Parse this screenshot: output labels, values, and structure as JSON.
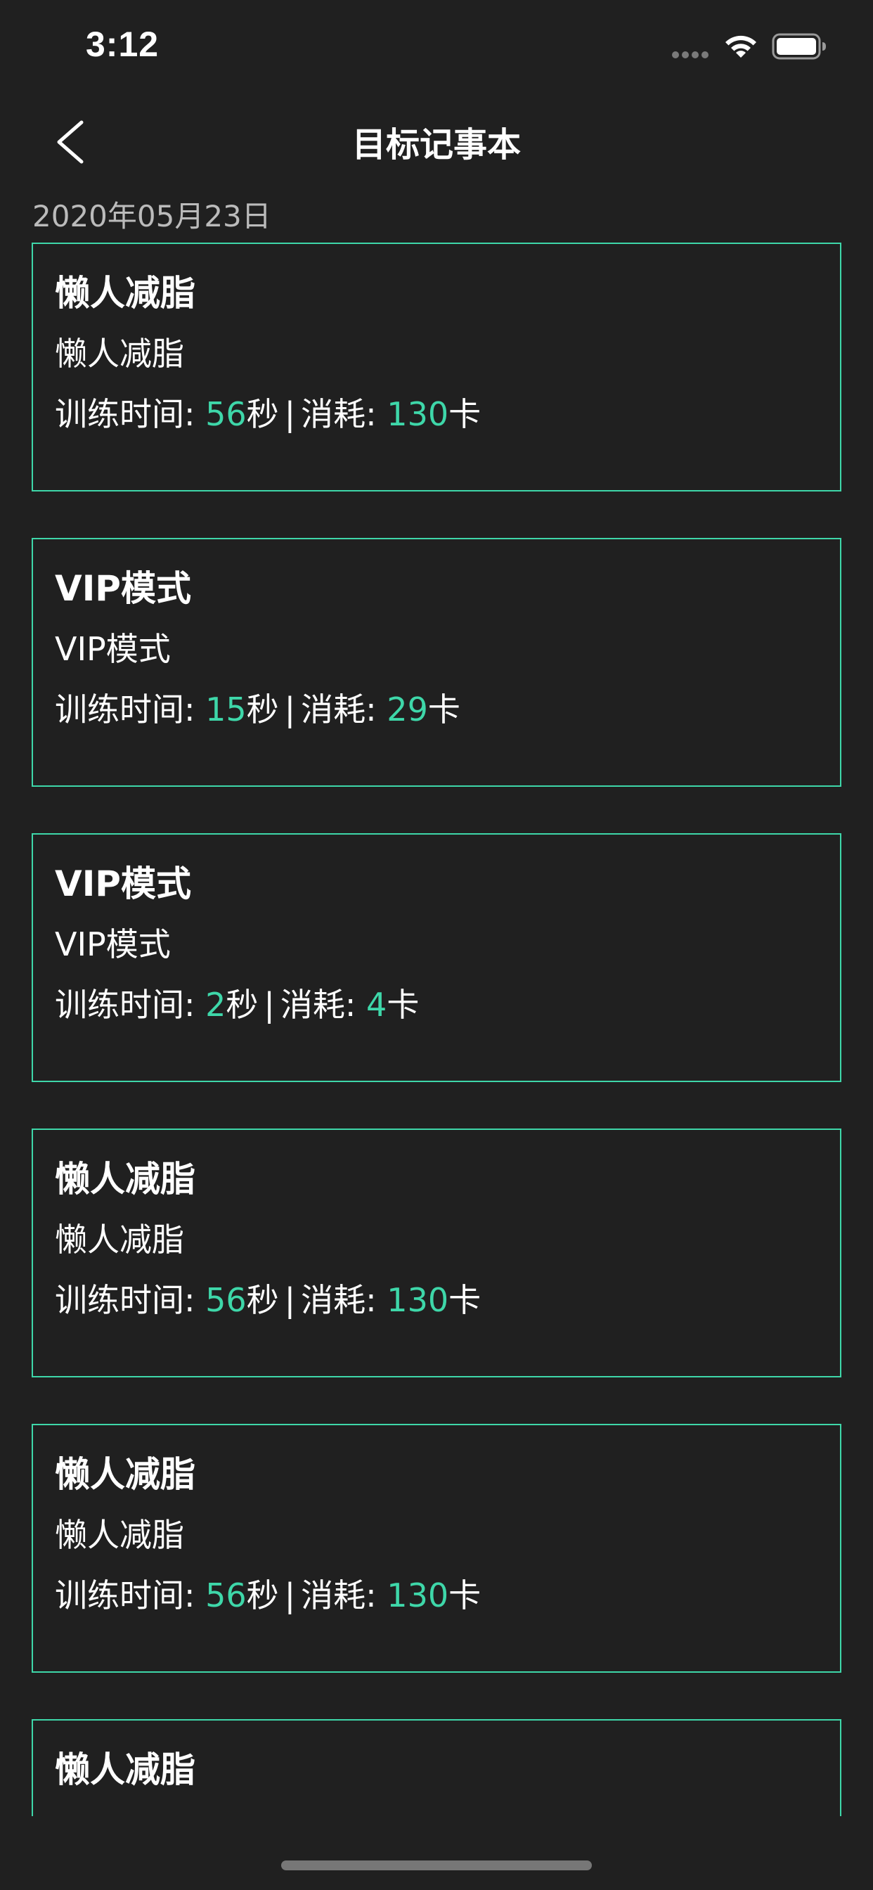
{
  "status_bar": {
    "time": "3:12"
  },
  "nav": {
    "title": "目标记事本",
    "back_icon": "chevron-left-icon"
  },
  "date_header": "2020年05月23日",
  "labels": {
    "training_time": "训练时间: ",
    "seconds_unit": "秒",
    "separator": "|",
    "consumption": "消耗: ",
    "calorie_unit": "卡"
  },
  "records": [
    {
      "title": "懒人减脂",
      "subtitle": "懒人减脂",
      "duration": "56",
      "calories": "130"
    },
    {
      "title": "VIP模式",
      "subtitle": "VIP模式",
      "duration": "15",
      "calories": "29"
    },
    {
      "title": "VIP模式",
      "subtitle": "VIP模式",
      "duration": "2",
      "calories": "4"
    },
    {
      "title": "懒人减脂",
      "subtitle": "懒人减脂",
      "duration": "56",
      "calories": "130"
    },
    {
      "title": "懒人减脂",
      "subtitle": "懒人减脂",
      "duration": "56",
      "calories": "130"
    },
    {
      "title": "懒人减脂",
      "subtitle": "",
      "duration": "",
      "calories": ""
    }
  ],
  "colors": {
    "background": "#202020",
    "accent": "#3ed7a9",
    "text": "#ffffff"
  }
}
